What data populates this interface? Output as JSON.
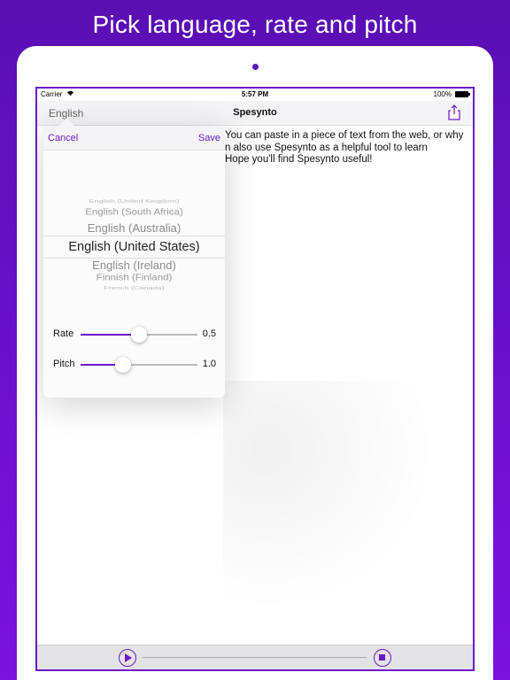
{
  "headline": "Pick language, rate and pitch",
  "statusbar": {
    "carrier": "Carrier",
    "time": "5:57 PM",
    "battery": "100%"
  },
  "navbar": {
    "left_button": "English",
    "title": "Spesynto",
    "right_icon": "share-icon"
  },
  "body_text": [
    "You can paste in a piece of text from the web, or why",
    "n also use Spesynto as a helpful tool to learn",
    "Hope you'll find Spesynto useful!"
  ],
  "popover": {
    "cancel": "Cancel",
    "save": "Save",
    "languages": [
      "English (United Kingdom)",
      "English (South Africa)",
      "English (Australia)",
      "English (United States)",
      "English (Ireland)",
      "Finnish (Finland)",
      "French (Canada)"
    ],
    "selected_language": "English (United States)",
    "rate": {
      "label": "Rate",
      "value": "0.5",
      "fraction": 0.5
    },
    "pitch": {
      "label": "Pitch",
      "value": "1.0",
      "fraction": 0.36
    }
  },
  "toolbar": {
    "play_icon": "play-icon",
    "stop_icon": "stop-icon"
  },
  "colors": {
    "accent": "#6e17c9",
    "background_top": "#5a0fb4",
    "background_bottom": "#7a12e0"
  }
}
